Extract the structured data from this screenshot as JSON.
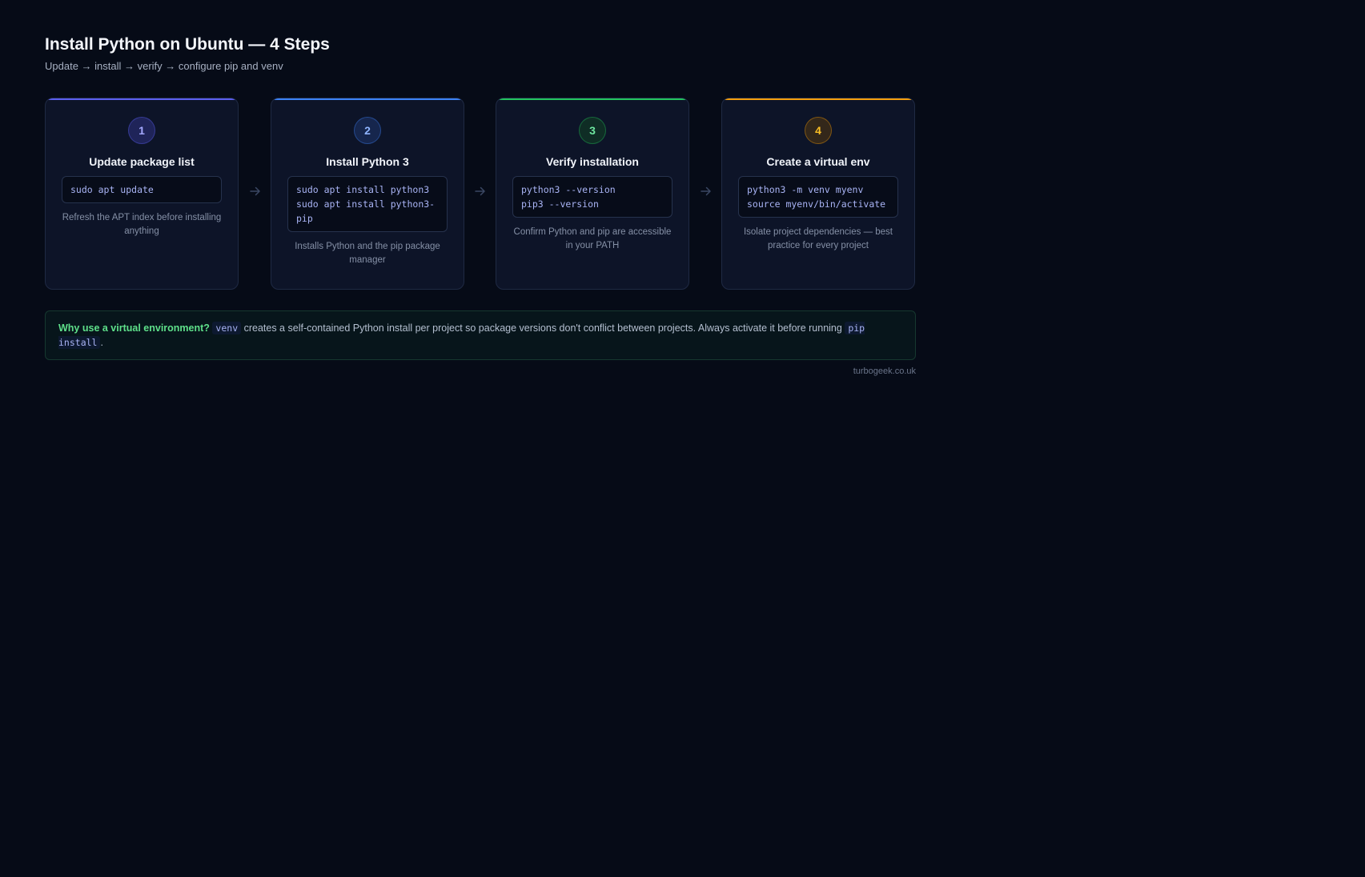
{
  "header": {
    "title": "Install Python on Ubuntu — 4 Steps",
    "subtitle": "Update → install → verify → configure pip and venv"
  },
  "steps": [
    {
      "number": "1",
      "title": "Update package list",
      "code": "sudo apt update",
      "description": "Refresh the APT index before installing anything",
      "accent": "#5b5ff0",
      "badge_bg": "#1f2459",
      "badge_fg": "#a4a8ff"
    },
    {
      "number": "2",
      "title": "Install Python 3",
      "code": "sudo apt install python3\nsudo apt install python3-pip",
      "description": "Installs Python and the pip package manager",
      "accent": "#3b82f6",
      "badge_bg": "#16264d",
      "badge_fg": "#8fb4ff"
    },
    {
      "number": "3",
      "title": "Verify installation",
      "code": "python3 --version\npip3 --version",
      "description": "Confirm Python and pip are accessible in your PATH",
      "accent": "#22c55e",
      "badge_bg": "#0f2d25",
      "badge_fg": "#6ee7a0"
    },
    {
      "number": "4",
      "title": "Create a virtual env",
      "code": "python3 -m venv myenv\nsource myenv/bin/activate",
      "description": "Isolate project dependencies — best practice for every project",
      "accent": "#f59e0b",
      "badge_bg": "#33271a",
      "badge_fg": "#fbbf24"
    }
  ],
  "arrow_icon": "arrow-right-icon",
  "note": {
    "lead": "Why use a virtual environment?",
    "code1": "venv",
    "text1": " creates a self-contained Python install per project so package versions don't conflict between projects. Always activate it before running ",
    "code2": "pip install",
    "text2": "."
  },
  "credit": "turbogeek.co.uk"
}
